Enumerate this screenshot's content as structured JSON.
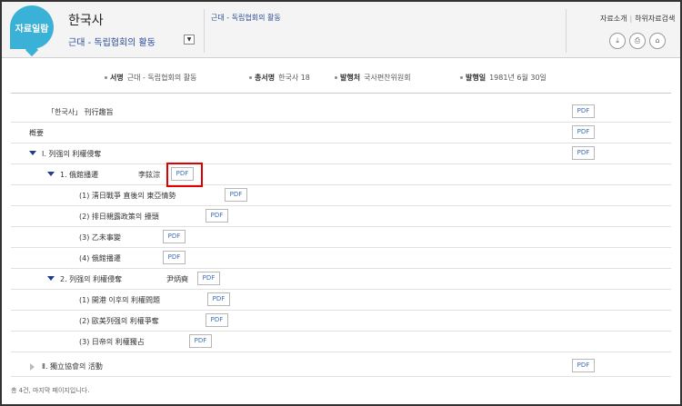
{
  "header": {
    "badge": "자료일람",
    "title": "한국사",
    "subtitle": "근대 - 독립협회의 활동",
    "path": "근대 - 독립협회의 활동",
    "links": [
      "자료소개",
      "하위자료검색"
    ],
    "tools": [
      "download-icon",
      "print-icon",
      "share-icon"
    ]
  },
  "meta": {
    "title_label": "서명",
    "title_value": "근대 - 독립협회의 활동",
    "series_label": "총서명",
    "series_value": "한국사 18",
    "publisher_label": "발행처",
    "publisher_value": "국사편찬위원회",
    "date_label": "발행일",
    "date_value": "1981년 6월 30일"
  },
  "pdf_label": "PDF",
  "rows": [
    {
      "text": "「한국사」 刊行趣旨"
    },
    {
      "text": "槪要"
    },
    {
      "text": "Ⅰ. 列强의 利權侵奪"
    },
    {
      "text": "1. 俄館播遷",
      "author": "李鉉淙"
    },
    {
      "text": "(1) 淸日戰爭 直後의 東亞情勢"
    },
    {
      "text": "(2) 排日親露政策의 擡頭"
    },
    {
      "text": "(3) 乙未事變"
    },
    {
      "text": "(4) 俄館播遷"
    },
    {
      "text": "2. 列强의 利權侵奪",
      "author": "尹炳奭"
    },
    {
      "text": "(1) 開港 이후의 利權問題"
    },
    {
      "text": "(2) 歐美列强의 利權爭奪"
    },
    {
      "text": "(3) 日帝의 利權獨占"
    },
    {
      "text": "Ⅱ. 獨立協會의 活動"
    }
  ],
  "footer": "총 4건, 마지막 페이지입니다."
}
